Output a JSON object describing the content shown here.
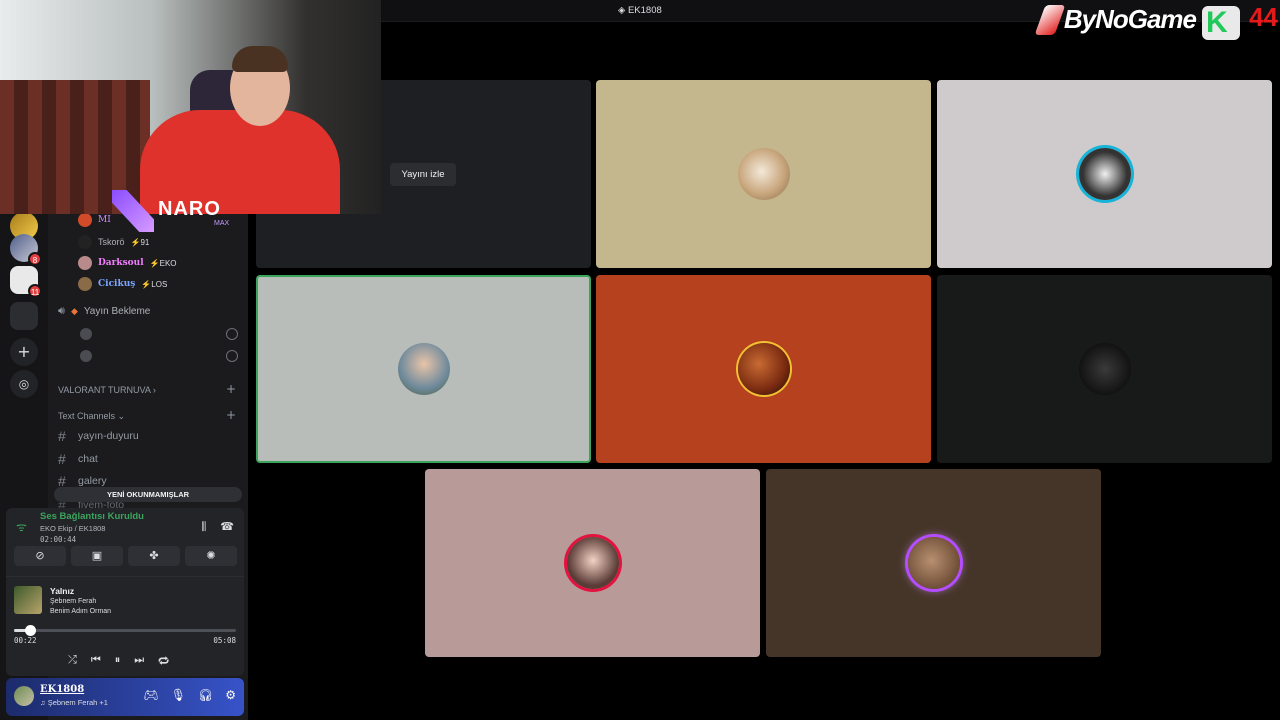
{
  "server_rail": {
    "badges": [
      "8",
      "11"
    ]
  },
  "sidebar": {
    "voice_users": [
      {
        "name": "MI",
        "tag": "",
        "color": "#d48bff"
      },
      {
        "name": "Tskorö",
        "tag": "⚡91",
        "color": "#aeb1b6"
      },
      {
        "name": "Darksoul",
        "tag": "⚡EKO",
        "color": "#f47fff"
      },
      {
        "name": "Cicikuş",
        "tag": "⚡LOS",
        "color": "#7aa7ff"
      }
    ],
    "voice_channel": "Yayın Bekleme",
    "categories": [
      {
        "label": "VALORANT TURNUVA ›"
      },
      {
        "label": "Text Channels ⌄"
      }
    ],
    "text_channels": [
      {
        "label": "yayın-duyuru"
      },
      {
        "label": "chat"
      },
      {
        "label": "galery"
      },
      {
        "label": "fivem-foto"
      }
    ],
    "unread_label": "YENİ OKUNMAMIŞLAR"
  },
  "voice_panel": {
    "status": "Ses Bağlantısı Kuruldu",
    "subtitle": "EKO Ekip / EK1808",
    "time": "02:00:44"
  },
  "music": {
    "title": "Yalnız",
    "artist": "Şebnem Ferah",
    "album": "Benim Adım Orman",
    "current": "00:22",
    "duration": "05:08",
    "progress": 0.07
  },
  "user": {
    "name": "EK1808",
    "status": "♫ Şebnem Ferah +1"
  },
  "main": {
    "channel_title": "EK1808",
    "watch_label": "Yayını izle"
  },
  "overlay": {
    "naro_text": "NARO",
    "naro_sub": "MAX",
    "brand": "ByNoGame",
    "brand_k": "K",
    "brand_num": "44"
  },
  "colors": {
    "connected_green": "#3ba55d",
    "accent_blue": "#3753c8",
    "tile_beige": "#c4b78d",
    "tile_lightgray": "#cfcacc",
    "tile_gray": "#b9bdba",
    "tile_rust": "#b6411f",
    "tile_dark": "#181919",
    "tile_pink": "#b89b98",
    "tile_brown": "#453528"
  }
}
